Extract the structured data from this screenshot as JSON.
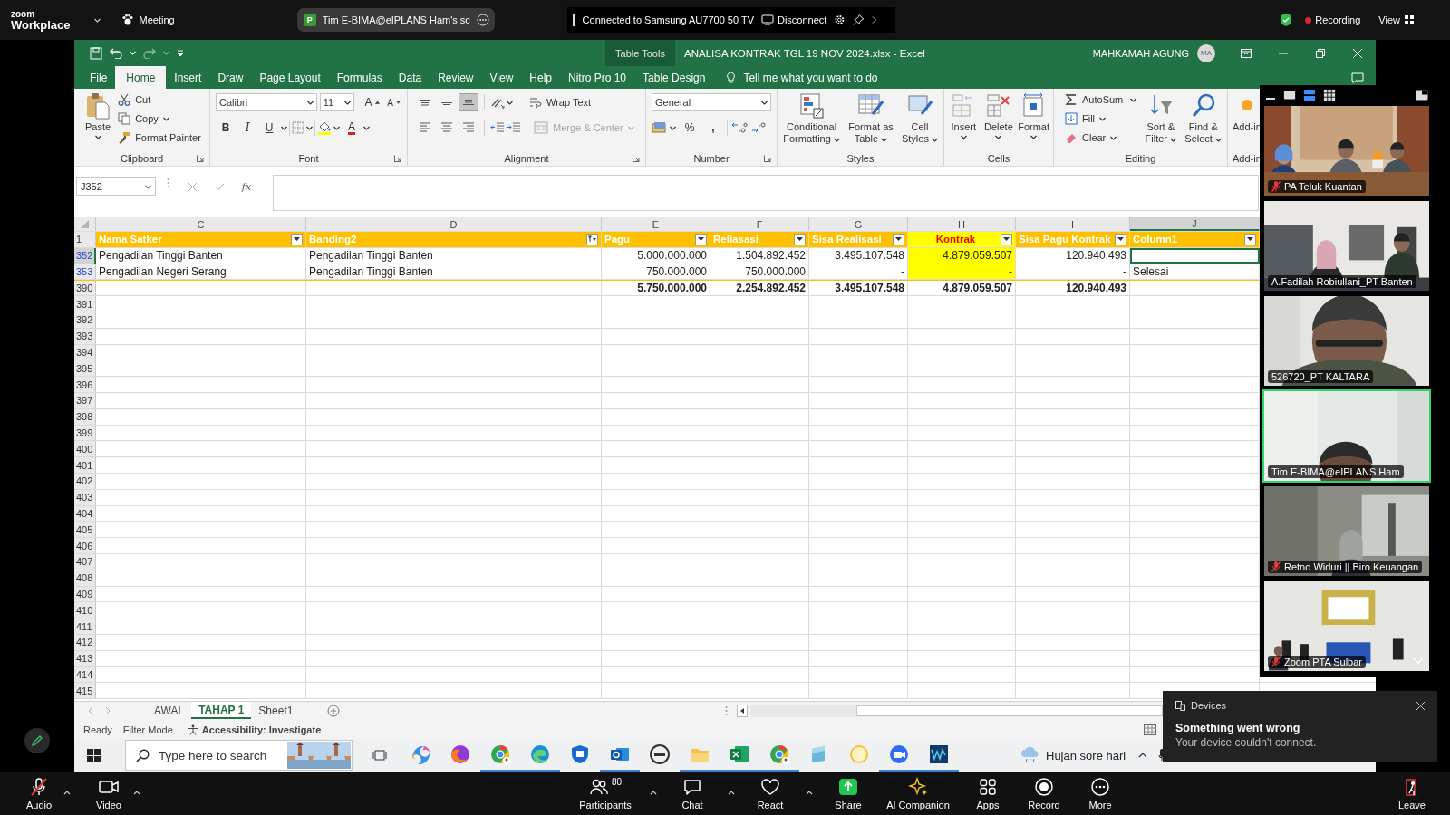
{
  "zoom_top_bar": {
    "brand": "zoom",
    "product": "Workplace",
    "meeting": "Meeting",
    "share_chip": {
      "initial": "P",
      "label": "Tim E-BIMA@eIPLANS Ham's sc"
    },
    "cast_status": "Connected to Samsung AU7700 50 TV",
    "disconnect": "Disconnect",
    "recording": "Recording",
    "view": "View"
  },
  "excel": {
    "table_tools": "Table Tools",
    "title": "ANALISA KONTRAK TGL 19 NOV 2024.xlsx - Excel",
    "user_name": "MAHKAMAH AGUNG",
    "user_initials": "MA",
    "tabs": [
      {
        "label": "File",
        "selected": false
      },
      {
        "label": "Home",
        "selected": true
      },
      {
        "label": "Insert",
        "selected": false
      },
      {
        "label": "Draw",
        "selected": false
      },
      {
        "label": "Page Layout",
        "selected": false
      },
      {
        "label": "Formulas",
        "selected": false
      },
      {
        "label": "Data",
        "selected": false
      },
      {
        "label": "Review",
        "selected": false
      },
      {
        "label": "View",
        "selected": false
      },
      {
        "label": "Help",
        "selected": false
      },
      {
        "label": "Nitro Pro 10",
        "selected": false
      },
      {
        "label": "Table Design",
        "selected": false
      }
    ],
    "tell_me": "Tell me what you want to do",
    "ribbon": {
      "clipboard": {
        "paste": "Paste",
        "cut": "Cut",
        "copy": "Copy",
        "format_painter": "Format Painter",
        "label": "Clipboard"
      },
      "font": {
        "name": "Calibri",
        "size": "11",
        "grow": "A",
        "shrink": "A",
        "bold": "B",
        "italic": "I",
        "underline": "U",
        "font_color": "A",
        "label": "Font"
      },
      "alignment": {
        "vertical": [
          {
            "selected": false
          },
          {
            "selected": false
          },
          {
            "selected": true
          }
        ],
        "horizontal": [
          {
            "selected": false
          },
          {
            "selected": false
          },
          {
            "selected": false
          }
        ],
        "wrap_text": "Wrap Text",
        "merge": {
          "label": "Merge & Center",
          "disabled": true
        },
        "label": "Alignment"
      },
      "number": {
        "format": "General",
        "percent": "%",
        "comma": ",",
        "label": "Number"
      },
      "styles": {
        "buttons": [
          "Conditional Formatting",
          "Format as Table",
          "Cell Styles"
        ],
        "label": "Styles"
      },
      "cells": {
        "buttons": [
          "Insert",
          "Delete",
          "Format"
        ],
        "label": "Cells"
      },
      "editing": {
        "autosum": "AutoSum",
        "fill": "Fill",
        "clear": "Clear",
        "buttons": [
          "Sort & Filter",
          "Find & Select"
        ],
        "label": "Editing"
      },
      "addins": {
        "button": "Add-in",
        "label": "Add-in"
      }
    },
    "name_box": "J352",
    "fx": "fx",
    "sheet": {
      "columns": [
        {
          "letter": "C",
          "header": "Nama Satker",
          "right_aligned": false,
          "filter_applied": false,
          "highlighted": false,
          "selected": false
        },
        {
          "letter": "D",
          "header": "Banding2",
          "right_aligned": false,
          "filter_applied": true,
          "highlighted": false,
          "selected": false
        },
        {
          "letter": "E",
          "header": "Pagu",
          "right_aligned": true,
          "filter_applied": false,
          "highlighted": false,
          "selected": false
        },
        {
          "letter": "F",
          "header": "Reliasasi",
          "right_aligned": true,
          "filter_applied": false,
          "highlighted": false,
          "selected": false
        },
        {
          "letter": "G",
          "header": "Sisa Realisasi",
          "right_aligned": true,
          "filter_applied": false,
          "highlighted": false,
          "selected": false
        },
        {
          "letter": "H",
          "header": "Kontrak",
          "right_aligned": true,
          "filter_applied": false,
          "highlighted": true,
          "selected": false
        },
        {
          "letter": "I",
          "header": "Sisa Pagu Kontrak",
          "right_aligned": true,
          "filter_applied": false,
          "highlighted": false,
          "selected": false
        },
        {
          "letter": "J",
          "header": "Column1",
          "right_aligned": false,
          "filter_applied": false,
          "highlighted": false,
          "selected": true
        }
      ],
      "header_row_number": "1",
      "rows": [
        {
          "number": "352",
          "kind": "data",
          "filtered": true,
          "selected": true,
          "cells": [
            "Pengadilan Tinggi Banten",
            "Pengadilan Tinggi Banten",
            "5.000.000.000",
            "1.504.892.452",
            "3.495.107.548",
            "4.879.059.507",
            "120.940.493",
            null
          ]
        },
        {
          "number": "353",
          "kind": "data",
          "filtered": true,
          "selected": false,
          "cells": [
            "Pengadilan Negeri Serang",
            "Pengadilan Tinggi Banten",
            "750.000.000",
            "750.000.000",
            "-",
            "-",
            "-",
            "Selesai"
          ]
        },
        {
          "number": "390",
          "kind": "total",
          "filtered": false,
          "selected": false,
          "cells": [
            null,
            null,
            "5.750.000.000",
            "2.254.892.452",
            "3.495.107.548",
            "4.879.059.507",
            "120.940.493",
            null
          ]
        }
      ],
      "empty_rows": [
        "391",
        "392",
        "393",
        "394",
        "395",
        "396",
        "397",
        "398",
        "399",
        "400",
        "401",
        "402",
        "403",
        "404",
        "405",
        "406",
        "407",
        "408",
        "409",
        "410",
        "411",
        "412",
        "413",
        "414",
        "415"
      ]
    },
    "sheet_tabs": [
      {
        "label": "AWAL",
        "selected": false
      },
      {
        "label": "TAHAP 1",
        "selected": true
      },
      {
        "label": "Sheet1",
        "selected": false
      }
    ],
    "status_bar": {
      "ready": "Ready",
      "mode": "Filter Mode",
      "accessibility": "Accessibility: Investigate"
    }
  },
  "taskbar": {
    "search_placeholder": "Type here to search",
    "apps": [
      {
        "running": false
      },
      {
        "running": false
      },
      {
        "running": true
      },
      {
        "running": true
      },
      {
        "running": false
      },
      {
        "running": true
      },
      {
        "running": false
      },
      {
        "running": true
      },
      {
        "running": true
      },
      {
        "running": true
      },
      {
        "running": false
      },
      {
        "running": false
      },
      {
        "running": true
      },
      {
        "running": true
      }
    ],
    "weather": "Hujan sore hari"
  },
  "video_panel": {
    "view_modes": [
      {
        "selected": false
      },
      {
        "selected": true
      },
      {
        "selected": false
      }
    ],
    "tiles": [
      {
        "name": "PA Teluk Kuantan",
        "muted": true,
        "active": false
      },
      {
        "name": "A.Fadilah Robiullani_PT Banten",
        "muted": false,
        "active": false
      },
      {
        "name": "526720_PT KALTARA",
        "muted": false,
        "active": false
      },
      {
        "name": "Tim E-BIMA@eIPLANS Ham",
        "muted": false,
        "active": true
      },
      {
        "name": "Retno Widuri || Biro Keuangan",
        "muted": true,
        "active": false
      },
      {
        "name": "Zoom PTA Sulbar",
        "muted": true,
        "active": false
      }
    ]
  },
  "notification": {
    "source": "Devices",
    "title": "Something went wrong",
    "message": "Your device couldn't connect."
  },
  "zoom_toolbar": {
    "items": [
      {
        "label": "Audio",
        "kind": "audio",
        "muted": true,
        "menu": true
      },
      {
        "label": "Video",
        "kind": "video",
        "menu": true
      },
      {
        "label": "Participants",
        "kind": "participants",
        "count": "80",
        "menu": true
      },
      {
        "label": "Chat",
        "kind": "chat",
        "menu": true
      },
      {
        "label": "React",
        "kind": "react",
        "menu": true
      },
      {
        "label": "Share",
        "kind": "share",
        "menu": false
      },
      {
        "label": "AI Companion",
        "kind": "ai",
        "menu": false
      },
      {
        "label": "Apps",
        "kind": "apps",
        "menu": false
      },
      {
        "label": "Record",
        "kind": "record",
        "menu": false
      },
      {
        "label": "More",
        "kind": "more",
        "menu": false
      },
      {
        "label": "Leave",
        "kind": "leave",
        "menu": false
      }
    ]
  }
}
